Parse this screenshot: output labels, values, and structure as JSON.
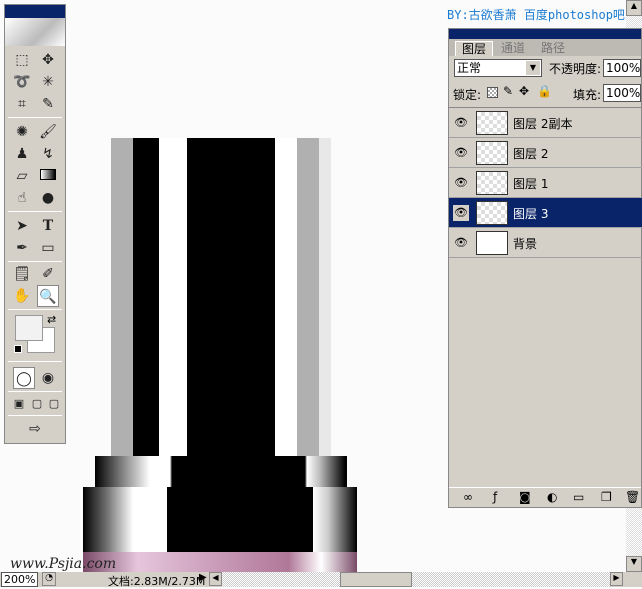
{
  "credit": "BY:古欲香萧  百度photoshop吧",
  "watermark": "www.Psjia.com",
  "layers_panel": {
    "tabs": [
      {
        "label": "图层"
      },
      {
        "label": "通道"
      },
      {
        "label": "路径"
      }
    ],
    "blend_mode": "正常",
    "opacity_label": "不透明度:",
    "opacity": "100%",
    "lock_label": "锁定:",
    "fill_label": "填充:",
    "fill": "100%",
    "layers": [
      {
        "name": "图层 2副本",
        "visible": true,
        "selected": false
      },
      {
        "name": "图层 2",
        "visible": true,
        "selected": false
      },
      {
        "name": "图层 1",
        "visible": true,
        "selected": false
      },
      {
        "name": "图层 3",
        "visible": true,
        "selected": true
      },
      {
        "name": "背景",
        "visible": true,
        "selected": false
      }
    ],
    "footer_icons": [
      "link-icon",
      "layer-style-icon",
      "mask-icon",
      "adjustment-icon",
      "folder-icon",
      "new-layer-icon",
      "trash-icon"
    ]
  },
  "status": {
    "zoom": "200%",
    "doc_info": "文档:2.83M/2.73M"
  },
  "colors": {
    "accent": "#0a246a",
    "chrome": "#d4d0c8"
  }
}
